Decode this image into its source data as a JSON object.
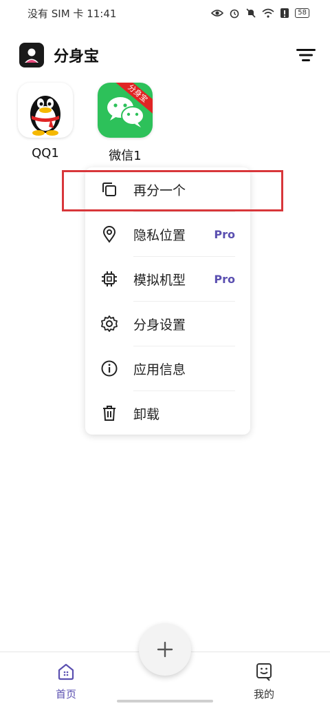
{
  "status_bar": {
    "carrier_time": "没有 SIM 卡 11:41",
    "battery": "58"
  },
  "header": {
    "title": "分身宝"
  },
  "apps": [
    {
      "label": "QQ1",
      "icon": "qq-penguin-icon"
    },
    {
      "label": "微信1",
      "icon": "wechat-icon",
      "ribbon": "分身宝"
    }
  ],
  "menu": {
    "items": [
      {
        "label": "再分一个",
        "icon": "copy-icon",
        "pro": ""
      },
      {
        "label": "隐私位置",
        "icon": "location-pin-icon",
        "pro": "Pro"
      },
      {
        "label": "模拟机型",
        "icon": "chip-icon",
        "pro": "Pro"
      },
      {
        "label": "分身设置",
        "icon": "gear-icon",
        "pro": ""
      },
      {
        "label": "应用信息",
        "icon": "info-icon",
        "pro": ""
      },
      {
        "label": "卸载",
        "icon": "trash-icon",
        "pro": ""
      }
    ]
  },
  "bottom_nav": {
    "home_label": "首页",
    "mine_label": "我的"
  },
  "colors": {
    "accent": "#5a4fb0",
    "highlight": "#d8363a",
    "wechat_green": "#2dc15a"
  }
}
